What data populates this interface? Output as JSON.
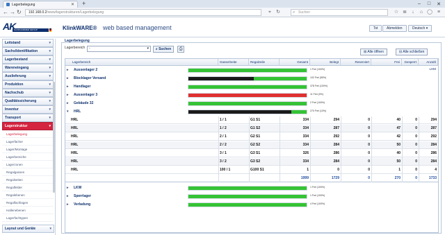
{
  "browser": {
    "tab_title": "Lagerbelegung",
    "url_host": "192.168.0.2",
    "url_path": "/www/lagerstrukturen/Lagerbelegung",
    "search_placeholder": "Suchen"
  },
  "header": {
    "logo_text": "AK",
    "logo_sub": "KLINKHAMMER GROUP",
    "brand": "KlinkWARE®",
    "subtitle": "web based management",
    "buttons": [
      "Tst",
      "Abmelden",
      "Deutsch"
    ]
  },
  "sidebar": {
    "items": [
      {
        "label": "Leitstand"
      },
      {
        "label": "Sachs/Identifikation"
      },
      {
        "label": "Lagerbestand"
      },
      {
        "label": "Wareneingang"
      },
      {
        "label": "Auslieferung"
      },
      {
        "label": "Produktion"
      },
      {
        "label": "Nachschub"
      },
      {
        "label": "Qualitätssicherung"
      },
      {
        "label": "Inventur"
      },
      {
        "label": "Transport"
      },
      {
        "label": "Lagerstruktur"
      }
    ],
    "subitems": [
      {
        "label": "Lagerbelegung",
        "selected": true
      },
      {
        "label": "Lagerfächer",
        "selected": false
      },
      {
        "label": "Lager/Montage",
        "selected": false
      },
      {
        "label": "Lagerbereiche",
        "selected": false
      },
      {
        "label": "Lagerzonen",
        "selected": false
      },
      {
        "label": "Regalgassen",
        "selected": false
      },
      {
        "label": "Regalseiten",
        "selected": false
      },
      {
        "label": "Regalfelder",
        "selected": false
      },
      {
        "label": "Regalebenen",
        "selected": false
      },
      {
        "label": "Regalfachlagen",
        "selected": false
      },
      {
        "label": "Hallenebenen",
        "selected": false
      },
      {
        "label": "Lagerfachtypen",
        "selected": false
      }
    ],
    "bottom_item": "Layout und Geräte"
  },
  "main": {
    "panel_title": "Lagerbelegung",
    "filter_label": "Lagerbereich",
    "filter_value": "-",
    "search_button": "Suchen",
    "expand_all": "Alle öffnen",
    "collapse_all": "Alle schließen",
    "columns": [
      "Lagerbereich",
      "Gasse/Seite",
      "Regalzeile",
      "Gesamt",
      "Belegt",
      "Reserviert",
      "Frei",
      "Gesperrt",
      "Anzahl LHM"
    ],
    "groups_top": [
      {
        "name": "Aussenlager 2",
        "fill_percent": 100,
        "color": "#35c335",
        "label": "1 Frei (100%)"
      },
      {
        "name": "Blocklager Versand",
        "fill_percent": 55,
        "color": "#1b1b1b",
        "label": "102 Frei (55%)"
      },
      {
        "name": "Handlager",
        "fill_percent": 100,
        "color": "#35c335",
        "label": "378 Frei (100%)"
      },
      {
        "name": "Aussenlager 3",
        "fill_percent": 100,
        "color": "#e03030",
        "label": "11 Frei (0%)"
      },
      {
        "name": "Gebäude 32",
        "fill_percent": 100,
        "color": "#35c335",
        "label": "2 Frei (100%)"
      },
      {
        "name": "HRL",
        "fill_percent": 87,
        "color": "#1b1b1b",
        "label": "270 Frei (13%)"
      }
    ],
    "rows": [
      {
        "area": "HRL",
        "aisle": "1 / 1",
        "rack": "G1 S1",
        "total": "334",
        "used": "294",
        "reserved": "0",
        "free": "40",
        "blocked": "0",
        "lhm": "294"
      },
      {
        "area": "HRL",
        "aisle": "1 / 2",
        "rack": "G1 S2",
        "total": "334",
        "used": "287",
        "reserved": "0",
        "free": "47",
        "blocked": "0",
        "lhm": "287"
      },
      {
        "area": "HRL",
        "aisle": "2 / 1",
        "rack": "G2 S1",
        "total": "334",
        "used": "292",
        "reserved": "0",
        "free": "42",
        "blocked": "0",
        "lhm": "292"
      },
      {
        "area": "HRL",
        "aisle": "2 / 2",
        "rack": "G2 S2",
        "total": "334",
        "used": "284",
        "reserved": "0",
        "free": "50",
        "blocked": "0",
        "lhm": "284"
      },
      {
        "area": "HRL",
        "aisle": "3 / 1",
        "rack": "G3 S1",
        "total": "326",
        "used": "286",
        "reserved": "0",
        "free": "40",
        "blocked": "0",
        "lhm": "286"
      },
      {
        "area": "HRL",
        "aisle": "3 / 2",
        "rack": "G3 S2",
        "total": "334",
        "used": "284",
        "reserved": "0",
        "free": "50",
        "blocked": "0",
        "lhm": "284"
      },
      {
        "area": "HRL",
        "aisle": "100 / 1",
        "rack": "G100 S1",
        "total": "1",
        "used": "0",
        "reserved": "0",
        "free": "1",
        "blocked": "0",
        "lhm": "4"
      }
    ],
    "sum": {
      "total": "1999",
      "used": "1729",
      "reserved": "0",
      "free": "270",
      "blocked": "0",
      "lhm": "1733"
    },
    "groups_bottom": [
      {
        "name": "LKW",
        "fill_percent": 100,
        "color": "#35c335",
        "label": "1 Frei (100%)"
      },
      {
        "name": "Sperrlager",
        "fill_percent": 100,
        "color": "#35c335",
        "label": "1 Frei (100%)"
      },
      {
        "name": "Verladung",
        "fill_percent": 100,
        "color": "#35c335",
        "label": "4 Frei (100%)"
      }
    ]
  }
}
